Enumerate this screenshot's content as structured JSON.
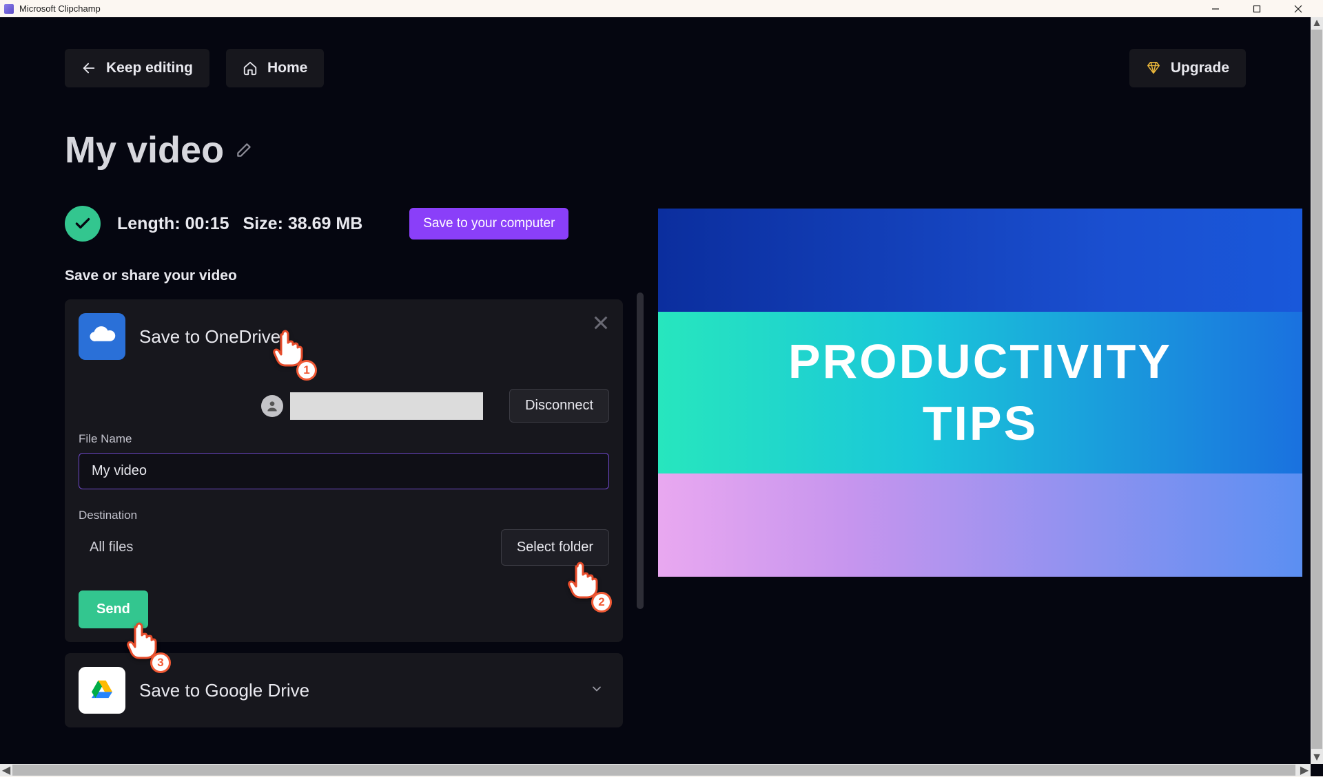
{
  "titlebar": {
    "app_name": "Microsoft Clipchamp"
  },
  "topbar": {
    "keep_editing": "Keep editing",
    "home": "Home",
    "upgrade": "Upgrade"
  },
  "video": {
    "title": "My video",
    "length_label": "Length:",
    "length_value": "00:15",
    "size_label": "Size:",
    "size_value": "38.69 MB",
    "save_computer": "Save to your computer"
  },
  "share": {
    "section_label": "Save or share your video",
    "onedrive": {
      "title": "Save to OneDrive",
      "disconnect": "Disconnect",
      "file_name_label": "File Name",
      "file_name_value": "My video",
      "destination_label": "Destination",
      "destination_value": "All files",
      "select_folder": "Select folder",
      "send": "Send"
    },
    "googledrive": {
      "title": "Save to Google Drive"
    }
  },
  "preview": {
    "line1": "PRODUCTIVITY",
    "line2": "TIPS"
  },
  "markers": {
    "m1": "1",
    "m2": "2",
    "m3": "3"
  }
}
